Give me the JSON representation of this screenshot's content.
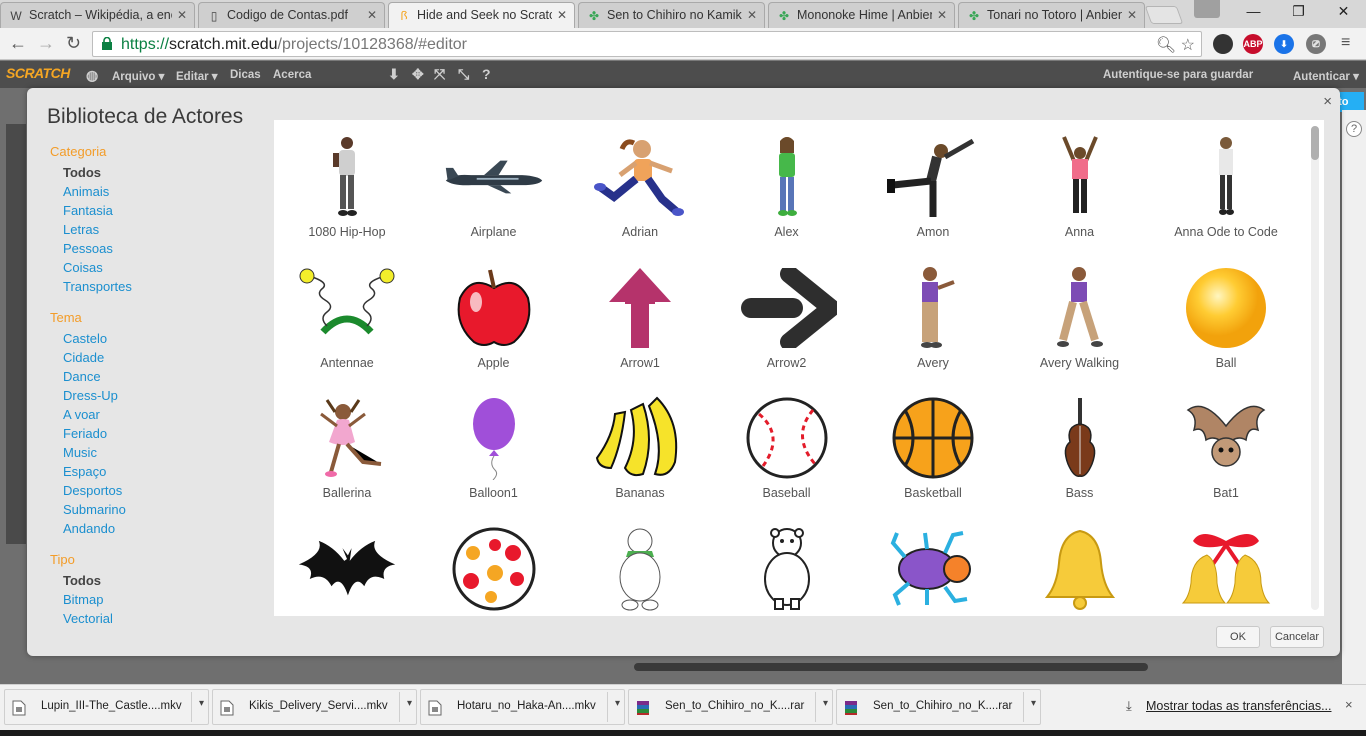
{
  "browser": {
    "tabs": [
      {
        "icon": "wikipedia-icon",
        "favicon": "W",
        "title": "Scratch – Wikipédia, a enc",
        "active": false
      },
      {
        "icon": "document-icon",
        "favicon": "▯",
        "title": "Codigo de Contas.pdf",
        "active": false
      },
      {
        "icon": "scratch-icon",
        "favicon": "ꟗ",
        "title": "Hide and Seek no Scratch",
        "active": true
      },
      {
        "icon": "clover-icon",
        "favicon": "✤",
        "title": "Sen to Chihiro no Kamikak",
        "active": false
      },
      {
        "icon": "clover-icon",
        "favicon": "✤",
        "title": "Mononoke Hime | Anbien",
        "active": false
      },
      {
        "icon": "clover-icon",
        "favicon": "✤",
        "title": "Tonari no Totoro | Anbien",
        "active": false
      }
    ],
    "url_scheme": "https://",
    "url_host": "scratch.mit.edu",
    "url_path": "/projects/10128368/#editor",
    "extensions": [
      {
        "name": "ublock-icon",
        "label": "",
        "color": "#333333"
      },
      {
        "name": "adblock-plus-icon",
        "label": "ABP",
        "color": "#c70d2c"
      },
      {
        "name": "download-icon",
        "label": "⬇",
        "color": "#1a73e8"
      },
      {
        "name": "cast-icon",
        "label": "⎚",
        "color": "#777777"
      }
    ]
  },
  "scratch_menu": {
    "logo": "SCRATCH",
    "items": [
      "Arquivo ▾",
      "Editar ▾",
      "Dicas",
      "Acerca"
    ],
    "save_label": "Autentique-se para guardar",
    "login_label": "Autenticar ▾",
    "project_button": "cto"
  },
  "dialog": {
    "title": "Biblioteca de Actores",
    "close": "×",
    "ok_label": "OK",
    "cancel_label": "Cancelar",
    "filter_groups": [
      {
        "heading": "Categoria",
        "items": [
          "Todos",
          "Animais",
          "Fantasia",
          "Letras",
          "Pessoas",
          "Coisas",
          "Transportes"
        ],
        "selected": "Todos"
      },
      {
        "heading": "Tema",
        "items": [
          "Castelo",
          "Cidade",
          "Dance",
          "Dress-Up",
          "A voar",
          "Feriado",
          "Music",
          "Espaço",
          "Desportos",
          "Submarino",
          "Andando"
        ],
        "selected": ""
      },
      {
        "heading": "Tipo",
        "items": [
          "Todos",
          "Bitmap",
          "Vectorial"
        ],
        "selected": "Todos"
      }
    ],
    "sprites": [
      {
        "name": "1080 Hip-Hop",
        "icon": "hiphop-dancer-icon"
      },
      {
        "name": "Airplane",
        "icon": "airplane-icon"
      },
      {
        "name": "Adrian",
        "icon": "runner-icon"
      },
      {
        "name": "Alex",
        "icon": "person-icon"
      },
      {
        "name": "Amon",
        "icon": "dancer-icon"
      },
      {
        "name": "Anna",
        "icon": "dancer-arms-up-icon"
      },
      {
        "name": "Anna Ode to Code",
        "icon": "person-standing-icon"
      },
      {
        "name": "Antennae",
        "icon": "antennae-icon"
      },
      {
        "name": "Apple",
        "icon": "apple-icon"
      },
      {
        "name": "Arrow1",
        "icon": "arrow-up-icon"
      },
      {
        "name": "Arrow2",
        "icon": "arrow-right-icon"
      },
      {
        "name": "Avery",
        "icon": "girl-icon"
      },
      {
        "name": "Avery Walking",
        "icon": "girl-walking-icon"
      },
      {
        "name": "Ball",
        "icon": "ball-icon"
      },
      {
        "name": "Ballerina",
        "icon": "ballerina-icon"
      },
      {
        "name": "Balloon1",
        "icon": "balloon-icon"
      },
      {
        "name": "Bananas",
        "icon": "bananas-icon"
      },
      {
        "name": "Baseball",
        "icon": "baseball-icon"
      },
      {
        "name": "Basketball",
        "icon": "basketball-icon"
      },
      {
        "name": "Bass",
        "icon": "double-bass-icon"
      },
      {
        "name": "Bat1",
        "icon": "bat-icon"
      },
      {
        "name": "",
        "icon": "bat-silhouette-icon"
      },
      {
        "name": "",
        "icon": "dotted-ball-icon"
      },
      {
        "name": "",
        "icon": "polar-bear-scarf-icon"
      },
      {
        "name": "",
        "icon": "polar-bear-icon"
      },
      {
        "name": "",
        "icon": "beetle-icon"
      },
      {
        "name": "",
        "icon": "bell-icon"
      },
      {
        "name": "",
        "icon": "bells-bow-icon"
      }
    ]
  },
  "downloads": {
    "items": [
      {
        "name": "Lupin_III-The_Castle....mkv",
        "icon": "video-file-icon"
      },
      {
        "name": "Kikis_Delivery_Servi....mkv",
        "icon": "video-file-icon"
      },
      {
        "name": "Hotaru_no_Haka-An....mkv",
        "icon": "video-file-icon"
      },
      {
        "name": "Sen_to_Chihiro_no_K....rar",
        "icon": "archive-file-icon"
      },
      {
        "name": "Sen_to_Chihiro_no_K....rar",
        "icon": "archive-file-icon"
      }
    ],
    "show_all": "Mostrar todas as transferências...",
    "close": "×"
  }
}
